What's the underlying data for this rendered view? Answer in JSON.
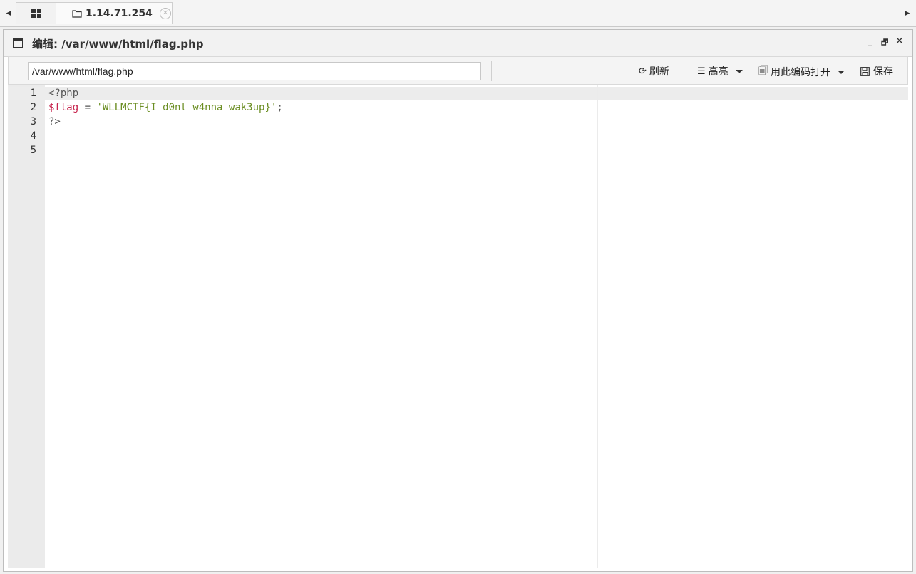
{
  "tabs": {
    "home_icon": "grid-icon",
    "server_tab": {
      "label": "1.14.71.254",
      "icon": "folder-icon"
    }
  },
  "window": {
    "title": "编辑: /var/www/html/flag.php",
    "controls": [
      "_",
      "🗗",
      "✕"
    ]
  },
  "toolbar": {
    "path_value": "/var/www/html/flag.php",
    "refresh_label": "刷新",
    "highlight_label": "高亮",
    "encoding_label": "用此编码打开",
    "save_label": "保存"
  },
  "editor": {
    "line_numbers": [
      "1",
      "2",
      "3",
      "4",
      "5"
    ],
    "lines": {
      "l1": "<?php",
      "l2_var": "$flag",
      "l2_op": " = ",
      "l2_str": "'WLLMCTF{I_d0nt_w4nna_wak3up}'",
      "l2_end": ";",
      "l3": "?>"
    }
  },
  "colors": {
    "variable": "#c7254e",
    "string": "#6b8e23",
    "gutter": "#ebebeb"
  }
}
